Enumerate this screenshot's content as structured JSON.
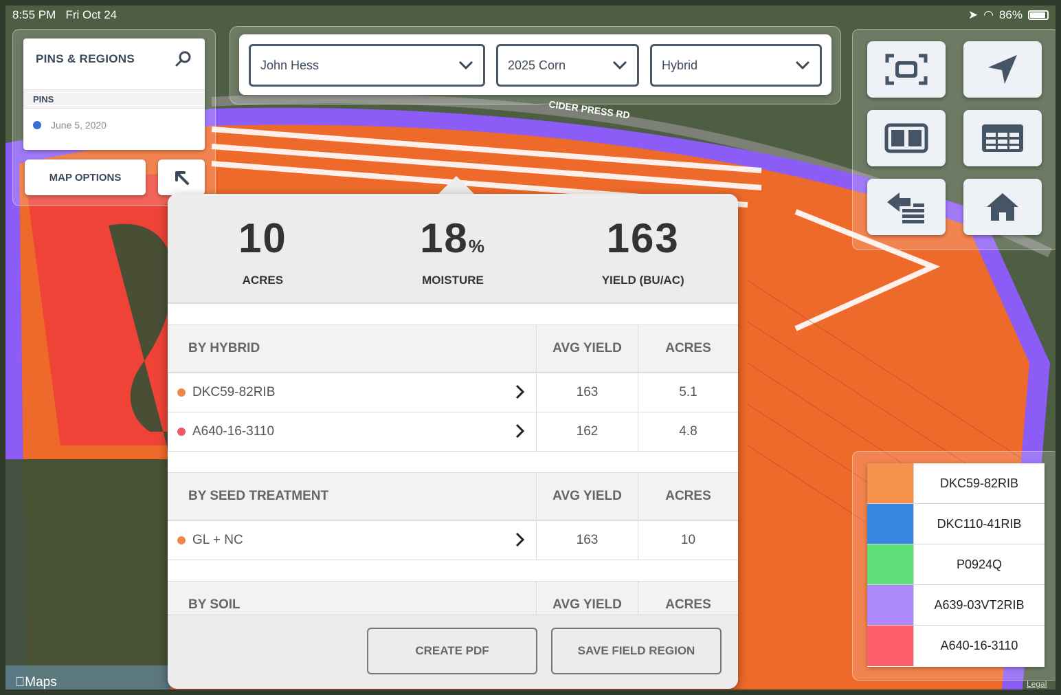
{
  "status_bar": {
    "time": "8:55 PM",
    "date": "Fri Oct 24",
    "battery": "86%"
  },
  "pins_panel": {
    "title": "PINS & REGIONS",
    "section": "PINS",
    "pins": [
      {
        "label": "June 5, 2020",
        "color": "#3a6fd8"
      }
    ]
  },
  "map_options_label": "MAP OPTIONS",
  "map_labels": {
    "road": "CIDER PRESS RD",
    "provider": "Maps",
    "legal": "Legal"
  },
  "filters": {
    "grower": "John Hess",
    "season": "2025 Corn",
    "layer": "Hybrid"
  },
  "summary": {
    "acres": {
      "value": "10",
      "label": "ACRES"
    },
    "moisture": {
      "value": "18",
      "unit": "%",
      "label": "MOISTURE"
    },
    "yield": {
      "value": "163",
      "label": "YIELD (BU/AC)"
    }
  },
  "columns": {
    "avg_yield": "AVG YIELD",
    "acres": "ACRES"
  },
  "sections": {
    "by_hybrid": {
      "title": "BY HYBRID",
      "rows": [
        {
          "name": "DKC59-82RIB",
          "avg_yield": "163",
          "acres": "5.1",
          "color": "#f0884a"
        },
        {
          "name": "A640-16-3110",
          "avg_yield": "162",
          "acres": "4.8",
          "color": "#f05a64"
        }
      ]
    },
    "by_seed_treatment": {
      "title": "BY SEED TREATMENT",
      "rows": [
        {
          "name": "GL + NC",
          "avg_yield": "163",
          "acres": "10",
          "color": "#f0884a"
        }
      ]
    },
    "by_soil": {
      "title": "BY SOIL"
    }
  },
  "buttons": {
    "create_pdf": "CREATE PDF",
    "save_region": "SAVE FIELD REGION"
  },
  "legend": [
    {
      "label": "DKC59-82RIB",
      "color": "#f5914a"
    },
    {
      "label": "DKC110-41RIB",
      "color": "#3587e2"
    },
    {
      "label": "P0924Q",
      "color": "#5fe07a"
    },
    {
      "label": "A639-03VT2RIB",
      "color": "#ae89fb"
    },
    {
      "label": "A640-16-3110",
      "color": "#fd5f6a"
    }
  ],
  "icons": [
    "search-icon",
    "collapse-arrow-icon",
    "chevron-down-icon",
    "zoom-fit-icon",
    "location-arrow-icon",
    "split-view-icon",
    "table-view-icon",
    "back-list-icon",
    "home-icon",
    "chevron-right-icon"
  ]
}
